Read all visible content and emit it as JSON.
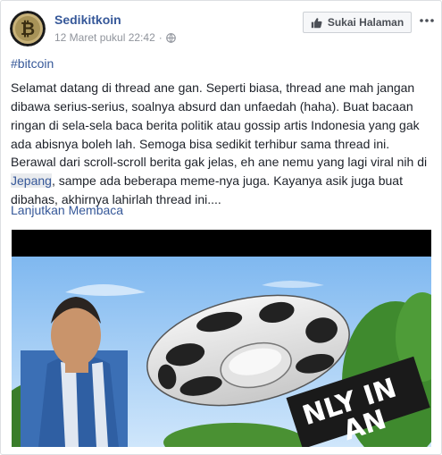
{
  "post": {
    "page_name": "Sedikitkoin",
    "timestamp": "12 Maret pukul 22:42",
    "separator": "·",
    "privacy_icon": "globe-icon",
    "like_page_label": "Sukai Halaman",
    "more_icon": "more-options-icon",
    "hashtag": "#bitcoin",
    "paragraph1": "Selamat datang di thread ane gan. Seperti biasa, thread ane mah jangan dibawa serius-serius, soalnya absurd dan unfaedah (haha). Buat bacaan ringan di sela-sela baca berita politik atau gossip artis Indonesia yang gak ada abisnya boleh lah. Semoga bisa sedikit terhibur sama thread ini.",
    "paragraph2_before": "Berawal dari scroll-scroll berita gak jelas, eh ane nemu yang lagi viral nih di ",
    "paragraph2_highlight": "Jepang",
    "paragraph2_after": ", sampe ada beberapa meme-nya juga. Kayanya asik juga buat dibahas, akhirnya lahirlah thread ini....",
    "read_more": "Lanjutkan Membaca",
    "image_overlay_text": "NLY IN\nAN",
    "colors": {
      "link": "#365899",
      "meta": "#90949c",
      "text": "#1d2129"
    }
  }
}
